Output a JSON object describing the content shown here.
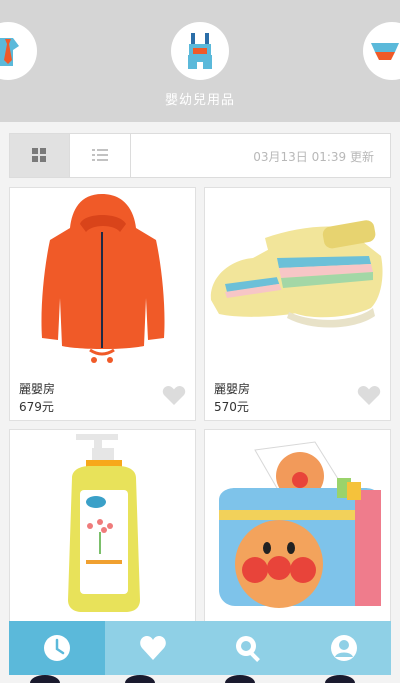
{
  "category": {
    "current_label": "嬰幼兒用品",
    "items": [
      {
        "icon": "shirt-tie-icon"
      },
      {
        "icon": "overalls-icon"
      },
      {
        "icon": "bowl-icon"
      }
    ]
  },
  "toolbar": {
    "update_text": "03月13日 01:39 更新",
    "views": [
      {
        "icon": "grid-view-icon",
        "selected": true
      },
      {
        "icon": "list-view-icon",
        "selected": false
      }
    ]
  },
  "products": [
    {
      "seller": "麗嬰房",
      "price": "679元",
      "image": "orange-hooded-jacket"
    },
    {
      "seller": "麗嬰房",
      "price": "570元",
      "image": "yellow-baby-shoes"
    },
    {
      "seller": "",
      "price": "",
      "image": "baby-shampoo-bottle"
    },
    {
      "seller": "",
      "price": "",
      "image": "anpanman-tissue-toy"
    }
  ],
  "bottom_nav": {
    "items": [
      {
        "icon": "clock-icon",
        "active": true
      },
      {
        "icon": "heart-icon",
        "active": false
      },
      {
        "icon": "search-icon",
        "active": false
      },
      {
        "icon": "user-icon",
        "active": false
      }
    ]
  },
  "colors": {
    "header_bg": "#d5d5d5",
    "nav_bg": "#8fd0e6",
    "nav_active": "#5bb9da",
    "accent_orange": "#f05a28"
  }
}
